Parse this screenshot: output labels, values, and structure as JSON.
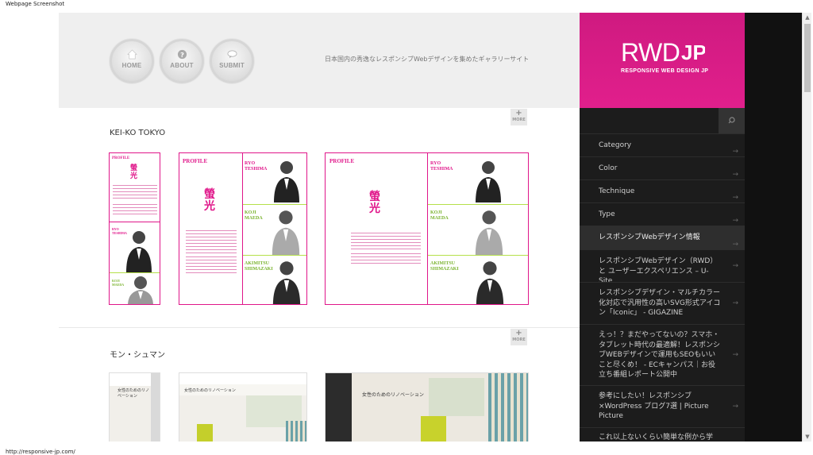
{
  "captions": {
    "top": "Webpage Screenshot",
    "bottom": "http://responsive-jp.com/"
  },
  "header": {
    "nav": [
      {
        "label": "HOME",
        "icon": "home-icon"
      },
      {
        "label": "ABOUT",
        "icon": "question-icon"
      },
      {
        "label": "SUBMIT",
        "icon": "speech-bubble-icon"
      }
    ],
    "tagline": "日本国内の秀逸なレスポンシブWebデザインを集めたギャラリーサイト"
  },
  "entries": [
    {
      "title": "KEI-KO TOKYO",
      "more_label": "MORE"
    },
    {
      "title": "モン・シュマン",
      "more_label": "MORE"
    }
  ],
  "shot_text": {
    "profile": "PROFILE",
    "kanji_1": "螢",
    "kanji_2": "光",
    "ryo": "RYO\nTESHIMA",
    "koji": "KOJI\nMAEDA",
    "akimitsu": "AKIMITSU\nSHIMAZAKI",
    "mon_heading": "女性のためのリノベーション"
  },
  "sidebar": {
    "logo_text": "RWD",
    "logo_jp": "JP",
    "logo_sub": "RESPONSIVE WEB DESIGN JP",
    "search_placeholder": "",
    "menu": [
      {
        "label": "Category"
      },
      {
        "label": "Color"
      },
      {
        "label": "Technique"
      },
      {
        "label": "Type"
      }
    ],
    "section_title": "レスポンシブWebデザイン情報",
    "links": [
      {
        "label": "レスポンシブWebデザイン（RWD）と ユーザーエクスペリエンス – U-Site"
      },
      {
        "label": "レスポンシブデザイン・マルチカラー化対応で汎用性の高いSVG形式アイコン「Iconic」 - GIGAZINE"
      },
      {
        "label": "えっ！？まだやってないの？スマホ・タブレット時代の最適解！レスポンシブWEBデザインで運用もSEOもいいこと尽くめ！ - ECキャンパス｜お役立ち番組レポート公開中"
      },
      {
        "label": "参考にしたい！レスポンシブ×WordPress ブログ7選 | Picture Picture"
      },
      {
        "label": "これ以上ないくらい簡単な例から学"
      }
    ]
  },
  "colors": {
    "accent": "#e0168a",
    "sidebar_bg": "#1c1c1c",
    "header_bg": "#efefef"
  }
}
